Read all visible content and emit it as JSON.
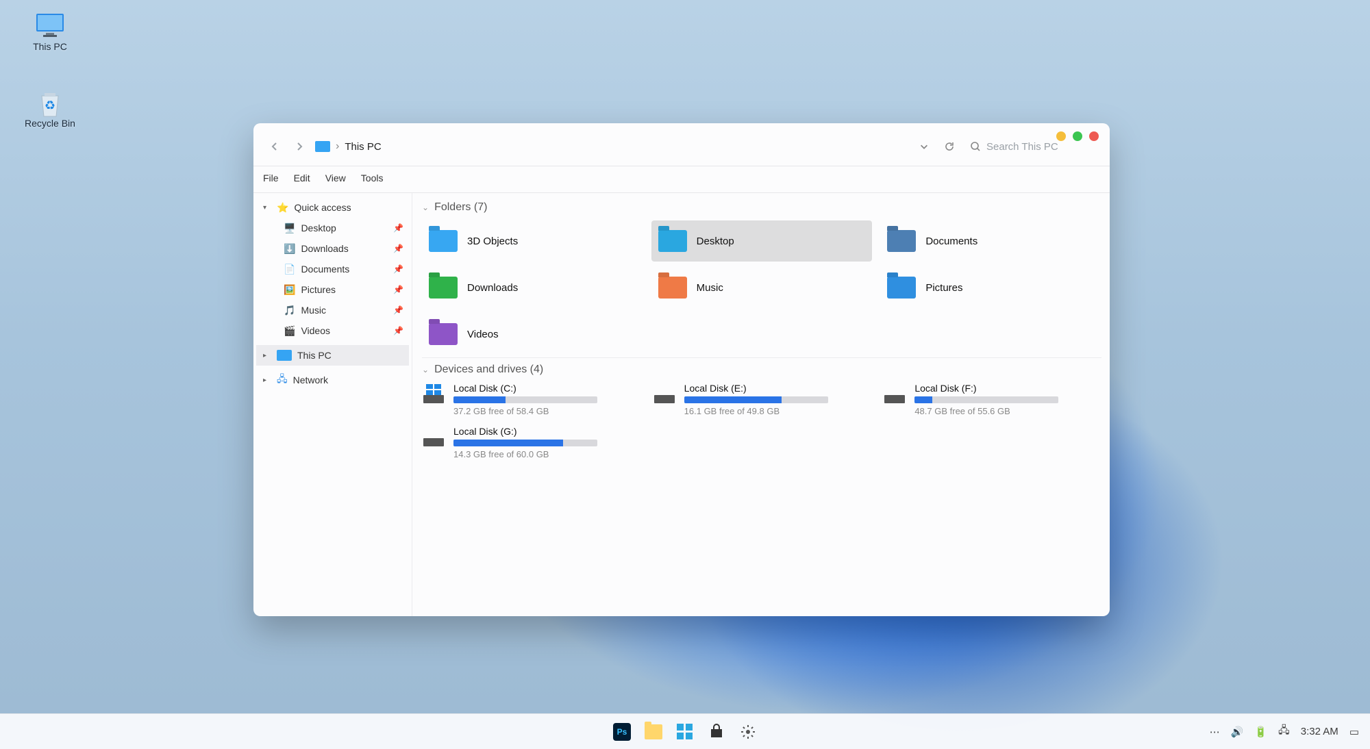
{
  "desktop_icons": [
    {
      "name": "this-pc",
      "label": "This PC"
    },
    {
      "name": "recycle-bin",
      "label": "Recycle Bin"
    }
  ],
  "window": {
    "controls": {
      "min": "#f5be3b",
      "max": "#3bc551",
      "close": "#ee5a52"
    },
    "address": {
      "location": "This PC",
      "search_placeholder": "Search This PC"
    },
    "menu": [
      "File",
      "Edit",
      "View",
      "Tools"
    ],
    "sidebar": {
      "quick_access": {
        "label": "Quick access",
        "items": [
          {
            "label": "Desktop",
            "icon": "desktop",
            "pinned": true
          },
          {
            "label": "Downloads",
            "icon": "downloads",
            "pinned": true
          },
          {
            "label": "Documents",
            "icon": "documents",
            "pinned": true
          },
          {
            "label": "Pictures",
            "icon": "pictures",
            "pinned": true
          },
          {
            "label": "Music",
            "icon": "music",
            "pinned": true
          },
          {
            "label": "Videos",
            "icon": "videos",
            "pinned": true
          }
        ]
      },
      "this_pc": {
        "label": "This PC",
        "selected": true
      },
      "network": {
        "label": "Network"
      }
    },
    "folders": {
      "heading": "Folders (7)",
      "items": [
        {
          "label": "3D Objects",
          "color": "#37a7f2"
        },
        {
          "label": "Desktop",
          "color": "#2aa7e0",
          "selected": true
        },
        {
          "label": "Documents",
          "color": "#4d7fb3"
        },
        {
          "label": "Downloads",
          "color": "#2fb24a"
        },
        {
          "label": "Music",
          "color": "#ef7a46"
        },
        {
          "label": "Pictures",
          "color": "#2f8fe0"
        },
        {
          "label": "Videos",
          "color": "#8e55c7"
        }
      ]
    },
    "drives": {
      "heading": "Devices and drives (4)",
      "items": [
        {
          "label": "Local Disk (C:)",
          "free": 37.2,
          "total": 58.4,
          "text": "37.2 GB free of 58.4 GB",
          "os": true
        },
        {
          "label": "Local Disk (E:)",
          "free": 16.1,
          "total": 49.8,
          "text": "16.1 GB free of 49.8 GB"
        },
        {
          "label": "Local Disk (F:)",
          "free": 48.7,
          "total": 55.6,
          "text": "48.7 GB free of 55.6 GB"
        },
        {
          "label": "Local Disk (G:)",
          "free": 14.3,
          "total": 60.0,
          "text": "14.3 GB free of 60.0 GB"
        }
      ]
    }
  },
  "taskbar": {
    "apps": [
      {
        "name": "photoshop",
        "label": "Ps"
      },
      {
        "name": "explorer"
      },
      {
        "name": "start"
      },
      {
        "name": "store"
      },
      {
        "name": "settings"
      }
    ],
    "tray": {
      "more": "⋯",
      "items": [
        "volume",
        "battery",
        "network"
      ],
      "time": "3:32 AM"
    }
  }
}
